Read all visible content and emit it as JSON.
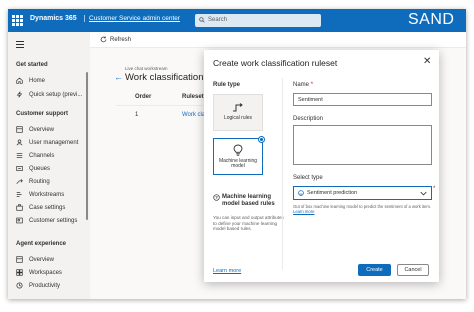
{
  "topbar": {
    "brand": "Dynamics 365",
    "app_name": "Customer Service admin center",
    "search_placeholder": "Search",
    "environment": "SAND"
  },
  "sidebar": {
    "groups": [
      {
        "label": "Get started",
        "items": [
          {
            "label": "Home",
            "icon": "home-icon"
          },
          {
            "label": "Quick setup (previ...",
            "icon": "quick-setup-icon"
          }
        ]
      },
      {
        "label": "Customer support",
        "items": [
          {
            "label": "Overview",
            "icon": "overview-icon"
          },
          {
            "label": "User management",
            "icon": "user-management-icon"
          },
          {
            "label": "Channels",
            "icon": "channels-icon"
          },
          {
            "label": "Queues",
            "icon": "queues-icon"
          },
          {
            "label": "Routing",
            "icon": "routing-icon"
          },
          {
            "label": "Workstreams",
            "icon": "workstreams-icon"
          },
          {
            "label": "Case settings",
            "icon": "case-settings-icon"
          },
          {
            "label": "Customer settings",
            "icon": "customer-settings-icon"
          }
        ]
      },
      {
        "label": "Agent experience",
        "items": [
          {
            "label": "Overview",
            "icon": "overview-icon"
          },
          {
            "label": "Workspaces",
            "icon": "workspaces-icon"
          },
          {
            "label": "Productivity",
            "icon": "productivity-icon"
          }
        ]
      }
    ]
  },
  "commandbar": {
    "refresh_label": "Refresh"
  },
  "main": {
    "breadcrumb": "Live chat workstream",
    "title": "Work classification",
    "table": {
      "headers": [
        "Order",
        "Ruleset"
      ],
      "rows": [
        {
          "order": "1",
          "ruleset": "Work classi"
        }
      ]
    }
  },
  "panel": {
    "title": "Create work classification ruleset",
    "rule_type_label": "Rule type",
    "options": [
      {
        "label": "Logical rules",
        "selected": false
      },
      {
        "label": "Machine learning model",
        "selected": true
      }
    ],
    "info_title": "Machine learning model based rules",
    "info_body": "You can input and output attributes to define your machine learning model based rules.",
    "learn_more": "Learn more",
    "name_label": "Name",
    "name_value": "Sentiment",
    "description_label": "Description",
    "description_value": "",
    "select_type_label": "Select type",
    "select_type_value": "Sentiment prediction",
    "select_help": "Out of box machine learning model to predict the sentiment of a work item.",
    "select_help_link": "Learn more",
    "create_label": "Create",
    "cancel_label": "Cancel"
  },
  "colors": {
    "accent": "#0f6cbd",
    "required": "#a4262c"
  }
}
